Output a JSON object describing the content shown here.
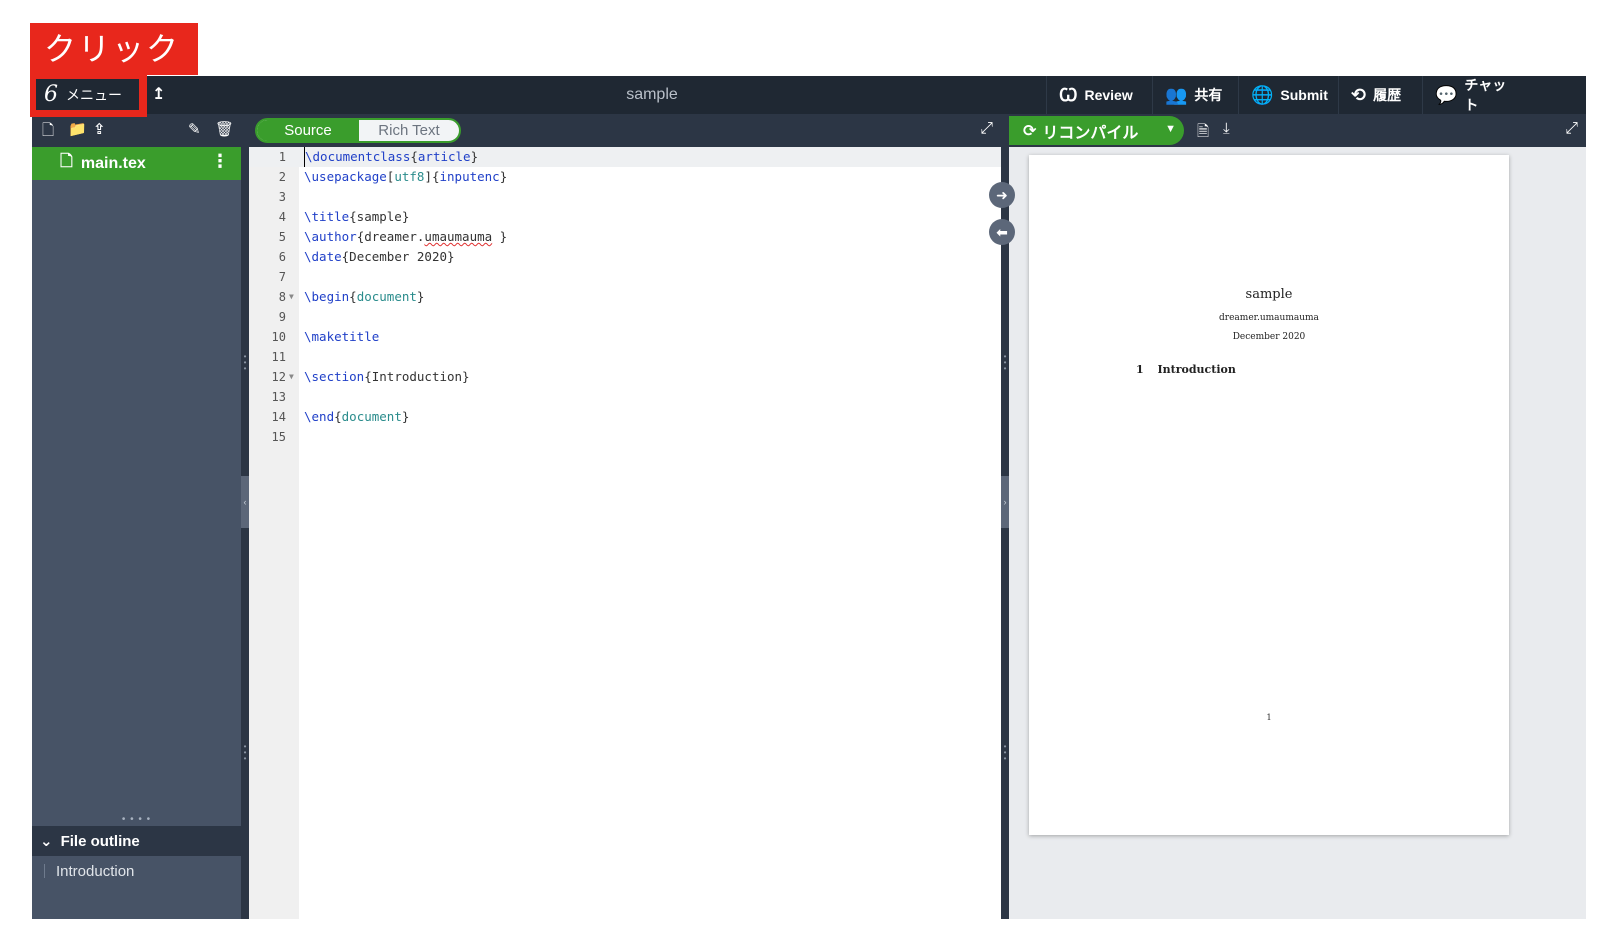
{
  "annotation": {
    "label": "クリック"
  },
  "toolbar": {
    "menu_label": "メニュー",
    "logo_glyph": "6",
    "up_icon": "↥",
    "project_title": "sample",
    "buttons": [
      {
        "name": "review",
        "icon": "review-icon",
        "glyph": "Ꞷ",
        "label": "Review"
      },
      {
        "name": "share",
        "icon": "users-icon",
        "glyph": "👥",
        "label": "共有"
      },
      {
        "name": "submit",
        "icon": "globe-icon",
        "glyph": "🌐",
        "label": "Submit"
      },
      {
        "name": "history",
        "icon": "history-icon",
        "glyph": "⟲",
        "label": "履歴"
      },
      {
        "name": "chat",
        "icon": "chat-icon",
        "glyph": "💬",
        "label": "チャット"
      }
    ]
  },
  "sidebar": {
    "toolbar_icons": [
      "new-file-icon",
      "new-folder-icon",
      "upload-icon",
      "rename-icon",
      "delete-icon"
    ],
    "files": [
      {
        "name": "main.tex",
        "selected": true
      }
    ],
    "outline": {
      "header": "File outline",
      "items": [
        "Introduction"
      ]
    }
  },
  "editor": {
    "mode_toggle": {
      "active": "Source",
      "inactive": "Rich Text"
    },
    "lines": [
      {
        "n": "1",
        "code": "\\documentclass{article}"
      },
      {
        "n": "2",
        "code": "\\usepackage[utf8]{inputenc}"
      },
      {
        "n": "3",
        "code": ""
      },
      {
        "n": "4",
        "code": "\\title{sample}"
      },
      {
        "n": "5",
        "code": "\\author{dreamer.umaumauma }"
      },
      {
        "n": "6",
        "code": "\\date{December 2020}"
      },
      {
        "n": "7",
        "code": ""
      },
      {
        "n": "8",
        "code": "\\begin{document}"
      },
      {
        "n": "9",
        "code": ""
      },
      {
        "n": "10",
        "code": "\\maketitle"
      },
      {
        "n": "11",
        "code": ""
      },
      {
        "n": "12",
        "code": "\\section{Introduction}"
      },
      {
        "n": "13",
        "code": ""
      },
      {
        "n": "14",
        "code": "\\end{document}"
      },
      {
        "n": "15",
        "code": ""
      }
    ]
  },
  "pdf": {
    "recompile_label": "リコンパイル",
    "page": {
      "title": "sample",
      "author": "dreamer.umaumauma",
      "date": "December 2020",
      "section_number": "1",
      "section_title": "Introduction",
      "page_number": "1"
    }
  },
  "colors": {
    "accent_green": "#3a9d2c",
    "toolbar_bg": "#1f2833",
    "sidebar_bg": "#475366",
    "annotation_red": "#e8271c"
  }
}
